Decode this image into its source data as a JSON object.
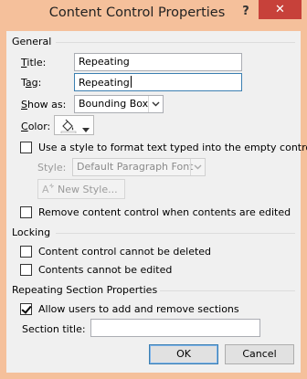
{
  "window": {
    "title": "Content Control Properties",
    "help_label": "?",
    "close_label": "✕"
  },
  "general": {
    "heading": "General",
    "title_label": "Title:",
    "title_value": "Repeating",
    "tag_label": "Tag:",
    "tag_value": "Repeating",
    "show_as_label": "Show as:",
    "show_as_value": "Bounding Box",
    "color_label": "Color:",
    "use_style_label": "Use a style to format text typed into the empty control",
    "use_style_checked": false,
    "style_label": "Style:",
    "style_value": "Default Paragraph Font",
    "new_style_label": "New Style...",
    "remove_label": "Remove content control when contents are edited",
    "remove_checked": false
  },
  "locking": {
    "heading": "Locking",
    "cannot_delete_label": "Content control cannot be deleted",
    "cannot_delete_checked": false,
    "cannot_edit_label": "Contents cannot be edited",
    "cannot_edit_checked": false
  },
  "repeating": {
    "heading": "Repeating Section Properties",
    "allow_label": "Allow users to add and remove sections",
    "allow_checked": true,
    "section_title_label": "Section title:",
    "section_title_value": ""
  },
  "buttons": {
    "ok_label": "OK",
    "cancel_label": "Cancel"
  },
  "icons": {
    "help": "help-icon",
    "close": "close-icon",
    "bucket": "paint-bucket-icon",
    "dropdown": "chevron-down-icon",
    "new_style": "new-style-icon"
  },
  "colors": {
    "title_bar": "#f5c09b",
    "close_button": "#c7413a",
    "dialog_bg": "#f0f0f0"
  }
}
